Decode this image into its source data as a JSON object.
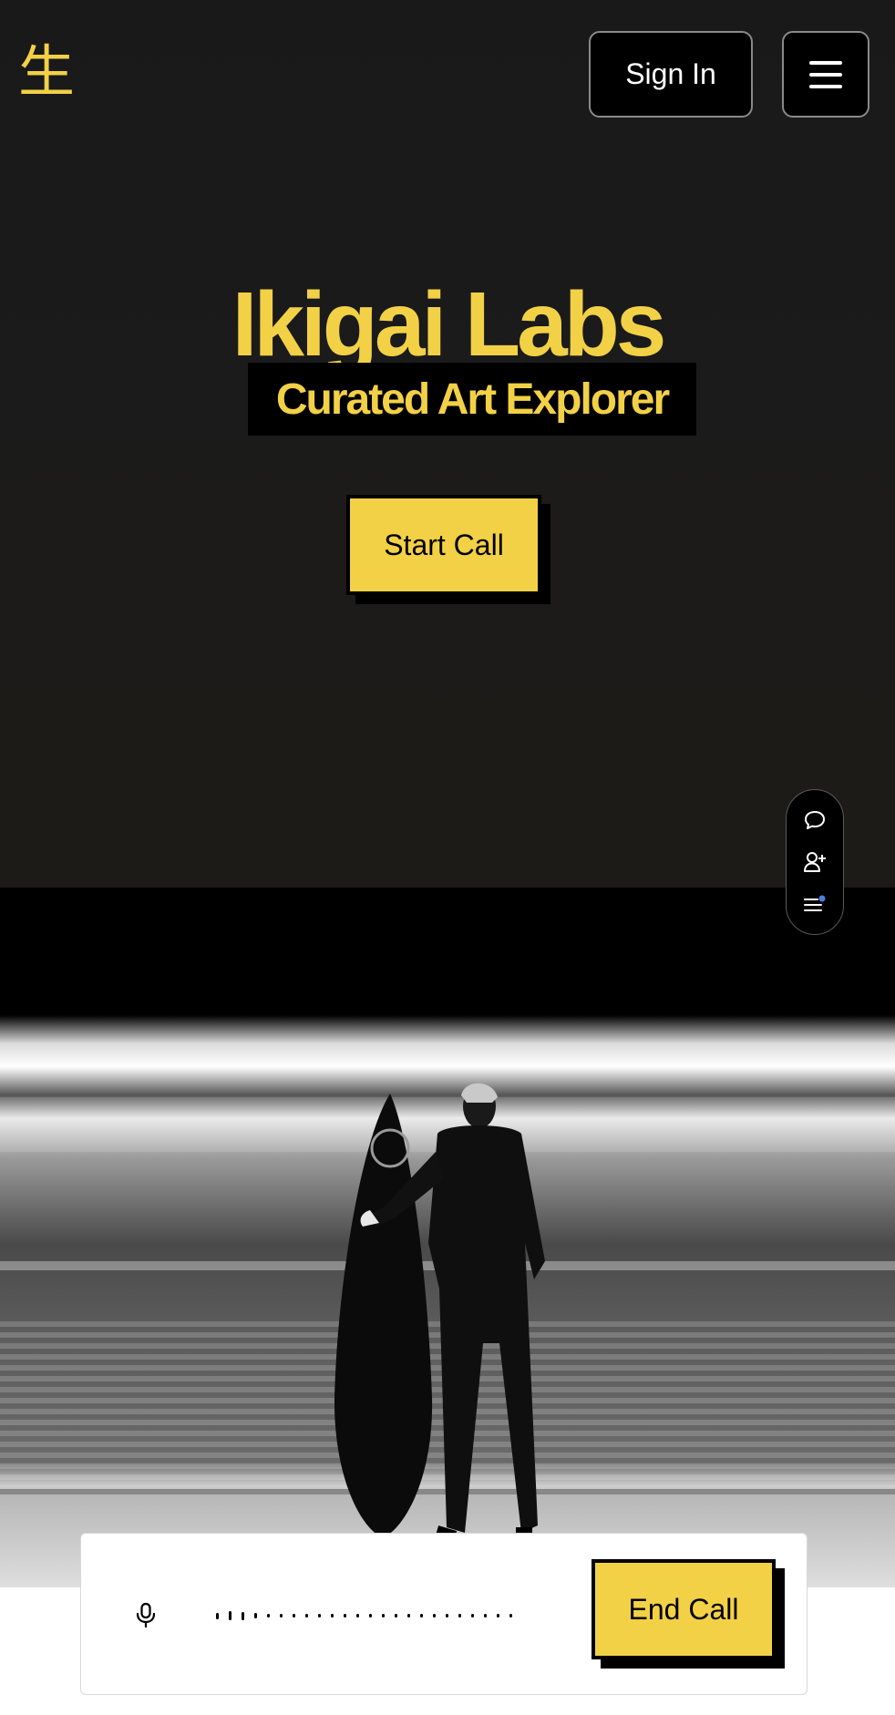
{
  "header": {
    "logo_glyph": "生",
    "sign_in_label": "Sign In",
    "menu_icon": "hamburger-menu-icon"
  },
  "hero": {
    "title": "Ikigai Labs",
    "subtitle": "Curated Art Explorer",
    "start_call_label": "Start Call"
  },
  "side_toolbar": {
    "items": [
      {
        "icon": "chat-bubble-icon"
      },
      {
        "icon": "add-user-icon"
      },
      {
        "icon": "list-notification-icon"
      }
    ]
  },
  "call_bar": {
    "mic_icon": "microphone-icon",
    "end_call_label": "End Call"
  },
  "colors": {
    "accent_yellow": "#f2d146",
    "hero_background": "#1b1b1b",
    "notification_dot": "#4a7fe0"
  }
}
